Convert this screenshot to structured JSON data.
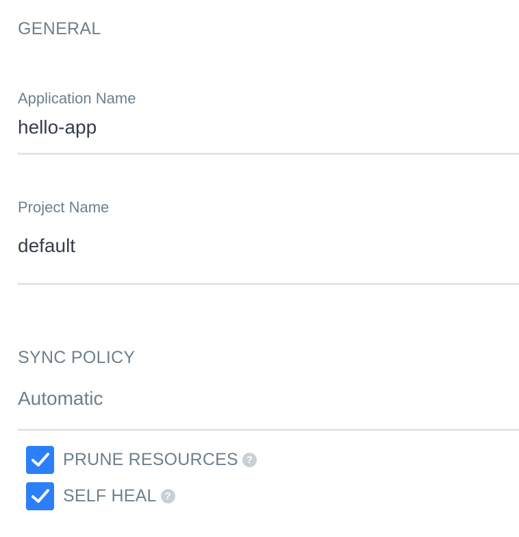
{
  "general": {
    "title": "GENERAL",
    "fields": [
      {
        "label": "Application Name",
        "value": "hello-app"
      },
      {
        "label": "Project Name",
        "value": "default"
      }
    ]
  },
  "sync_policy": {
    "title": "SYNC POLICY",
    "selected": "Automatic",
    "options": [
      {
        "label": "PRUNE RESOURCES",
        "checked": true,
        "help_icon": "question-circle-icon",
        "help_text": "?"
      },
      {
        "label": "SELF HEAL",
        "checked": true,
        "help_icon": "question-circle-icon",
        "help_text": "?"
      }
    ]
  },
  "colors": {
    "checkbox": "#2d7ff9",
    "label": "#6d7f8b",
    "value": "#363c4a",
    "underline": "#dee6eb",
    "help_icon": "#c8d0d6"
  }
}
